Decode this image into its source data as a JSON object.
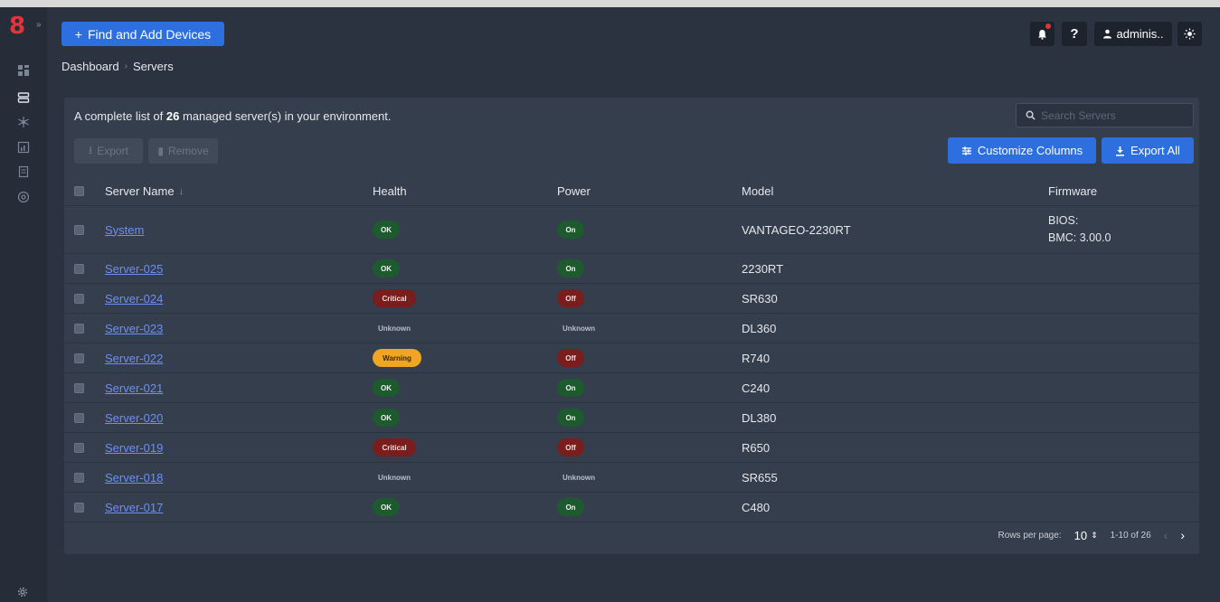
{
  "app": {
    "logo_glyph": "8",
    "brand_color": "#e0353b",
    "accent_color": "#2e6fe0"
  },
  "topbar": {
    "find_button_label": "Find and Add Devices",
    "find_button_icon": "plus-icon",
    "help_label": "?",
    "user_label": "adminis..",
    "bell_icon": "bell-icon",
    "theme_icon": "sun-icon"
  },
  "sidebar": {
    "expand_glyph": "»",
    "items": [
      {
        "icon": "dashboard-icon"
      },
      {
        "icon": "servers-icon",
        "active": true
      },
      {
        "icon": "network-icon"
      },
      {
        "icon": "reports-icon"
      },
      {
        "icon": "clipboard-icon"
      },
      {
        "icon": "shield-icon"
      }
    ],
    "settings_icon": "gear-icon"
  },
  "breadcrumb": {
    "items": [
      "Dashboard",
      "Servers"
    ]
  },
  "panel": {
    "summary_prefix": "A complete list of ",
    "summary_count": "26",
    "summary_suffix": " managed server(s) in your environment.",
    "search_placeholder": "Search Servers",
    "export_label": "Export",
    "remove_label": "Remove",
    "customize_label": "Customize Columns",
    "export_all_label": "Export All"
  },
  "table": {
    "columns": [
      "Server Name",
      "Health",
      "Power",
      "Model",
      "Firmware"
    ],
    "sort_indicator": "↓",
    "rows": [
      {
        "name": "System",
        "health": "OK",
        "power": "On",
        "model": "VANTAGEO-2230RT",
        "firmware": [
          "BIOS:",
          "BMC: 3.00.0"
        ]
      },
      {
        "name": "Server-025",
        "health": "OK",
        "power": "On",
        "model": "2230RT",
        "firmware": []
      },
      {
        "name": "Server-024",
        "health": "Critical",
        "power": "Off",
        "model": "SR630",
        "firmware": []
      },
      {
        "name": "Server-023",
        "health": "Unknown",
        "power": "Unknown",
        "model": "DL360",
        "firmware": []
      },
      {
        "name": "Server-022",
        "health": "Warning",
        "power": "Off",
        "model": "R740",
        "firmware": []
      },
      {
        "name": "Server-021",
        "health": "OK",
        "power": "On",
        "model": "C240",
        "firmware": []
      },
      {
        "name": "Server-020",
        "health": "OK",
        "power": "On",
        "model": "DL380",
        "firmware": []
      },
      {
        "name": "Server-019",
        "health": "Critical",
        "power": "Off",
        "model": "R650",
        "firmware": []
      },
      {
        "name": "Server-018",
        "health": "Unknown",
        "power": "Unknown",
        "model": "SR655",
        "firmware": []
      },
      {
        "name": "Server-017",
        "health": "OK",
        "power": "On",
        "model": "C480",
        "firmware": []
      }
    ]
  },
  "pagination": {
    "rows_per_page_label": "Rows per page:",
    "rows_per_page_value": "10",
    "range_label": "1-10 of 26",
    "prev_glyph": "‹",
    "next_glyph": "›"
  },
  "status_colors": {
    "ok": "#1d5b2e",
    "critical": "#7a1d1d",
    "warning": "#f0a524"
  }
}
